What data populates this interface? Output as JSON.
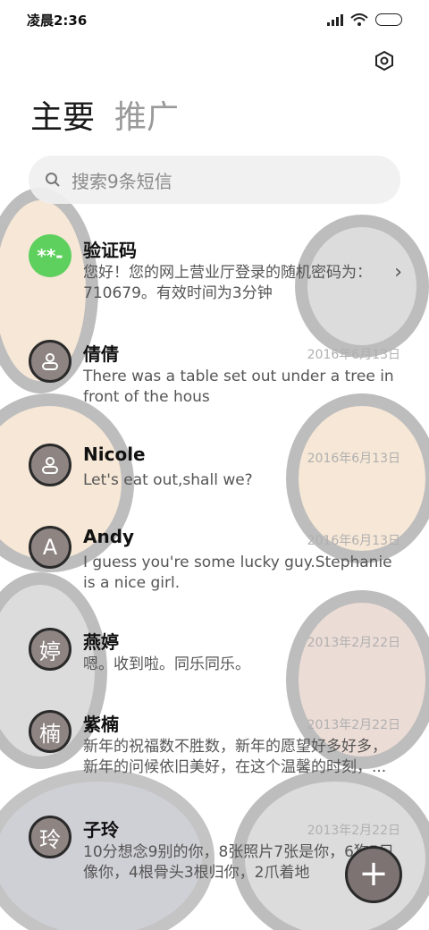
{
  "status": {
    "time": "凌晨2:36"
  },
  "tabs": [
    {
      "label": "主要"
    },
    {
      "label": "推广"
    }
  ],
  "search": {
    "placeholder": "搜索9条短信"
  },
  "conversations": [
    {
      "avatar": "**-",
      "name": "验证码",
      "date": "",
      "preview": "您好！您的网上营业厅登录的随机密码为：710679。有效时间为3分钟"
    },
    {
      "avatar": "person-icon",
      "name": "倩倩",
      "date": "2016年6月13日",
      "preview": "There was a table set out under a tree in front of the hous"
    },
    {
      "avatar": "person-icon",
      "name": "Nicole",
      "date": "2016年6月13日",
      "preview": "Let's eat out,shall we?"
    },
    {
      "avatar": "A",
      "name": "Andy",
      "date": "2016年6月13日",
      "preview": "I guess you're some lucky guy.Stephanie is a nice girl."
    },
    {
      "avatar": "婷",
      "name": "燕婷",
      "date": "2013年2月22日",
      "preview": "嗯。收到啦。同乐同乐。"
    },
    {
      "avatar": "楠",
      "name": "紫楠",
      "date": "2013年2月22日",
      "preview": "新年的祝福数不胜数，新年的愿望好多好多，新年的问候依旧美好，在这个温馨的时刻，..."
    },
    {
      "avatar": "玲",
      "name": "子玲",
      "date": "2013年2月22日",
      "preview": "10分想念9别的你，8张照片7张是你，6狗5只像你，4根骨头3根归你，2爪着地"
    }
  ],
  "fab": {
    "label": "+"
  },
  "colors": {
    "accent_green": "#5ed05e",
    "avatar_gray": "#8e8583"
  }
}
